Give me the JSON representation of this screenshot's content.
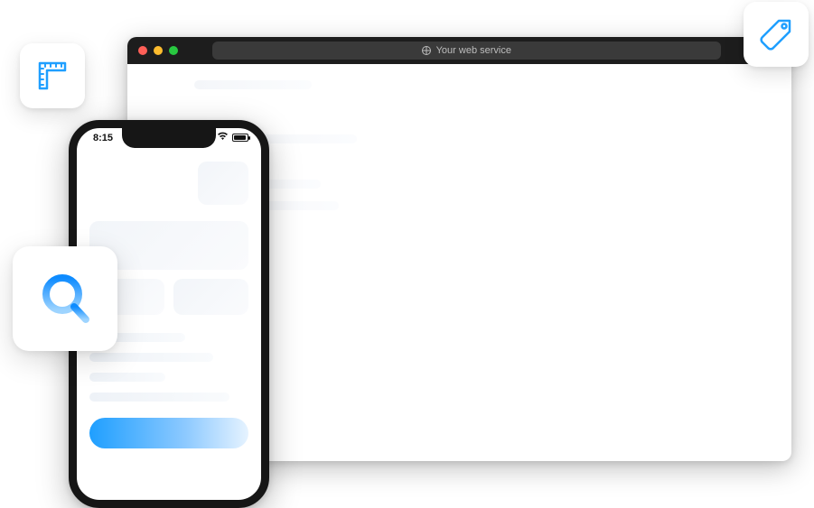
{
  "browser": {
    "address_text": "Your web service"
  },
  "phone": {
    "time": "8:15"
  },
  "colors": {
    "accent": "#1f9fff"
  }
}
